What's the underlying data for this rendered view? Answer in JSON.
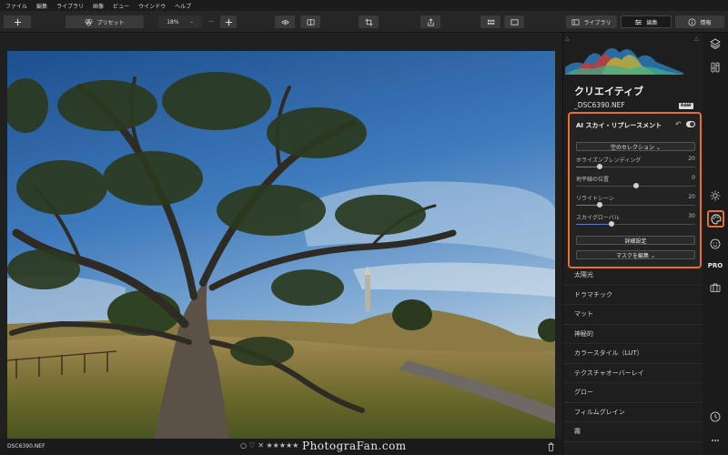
{
  "menu": [
    "ファイル",
    "編集",
    "ライブラリ",
    "画像",
    "ビュー",
    "ウインドウ",
    "ヘルプ"
  ],
  "toolbar": {
    "preset_label": "プリセット",
    "zoom_value": "18%",
    "zoom_dots": "···",
    "library_tab": "ライブラリ",
    "edit_tab": "編集",
    "info_tab": "情報"
  },
  "panel": {
    "title": "クリエイティブ",
    "filename": "_DSC6390.NEF",
    "raw_badge": "RAW"
  },
  "ai_sky": {
    "title": "AI スカイ・リプレースメント",
    "sky_select": "空のセレクション ⌄",
    "sliders": [
      {
        "name": "ホライズンブレンディング",
        "value": 20,
        "min": 0,
        "max": 100
      },
      {
        "name": "地平線の位置",
        "value": 0,
        "min": -100,
        "max": 100
      },
      {
        "name": "リライトシーン",
        "value": 20,
        "min": 0,
        "max": 100
      },
      {
        "name": "スカイグローバル",
        "value": 30,
        "min": 0,
        "max": 100
      }
    ],
    "advanced_button": "詳細設定",
    "edit_mask_button": "マスクを編集 ⌄"
  },
  "tools": [
    "太陽光",
    "ドラマチック",
    "マット",
    "神秘的",
    "カラースタイル（LUT）",
    "テクスチャオーバーレイ",
    "グロー",
    "フィルムグレイン",
    "霧"
  ],
  "bottom": {
    "filename": "DSC6390.NEF",
    "watermark": "PhotograFan.com",
    "rating": "○ ♡ ✕ ★★★★★"
  },
  "colors": {
    "accent": "#e8702a",
    "slider_fill": "#5f7ad0"
  }
}
